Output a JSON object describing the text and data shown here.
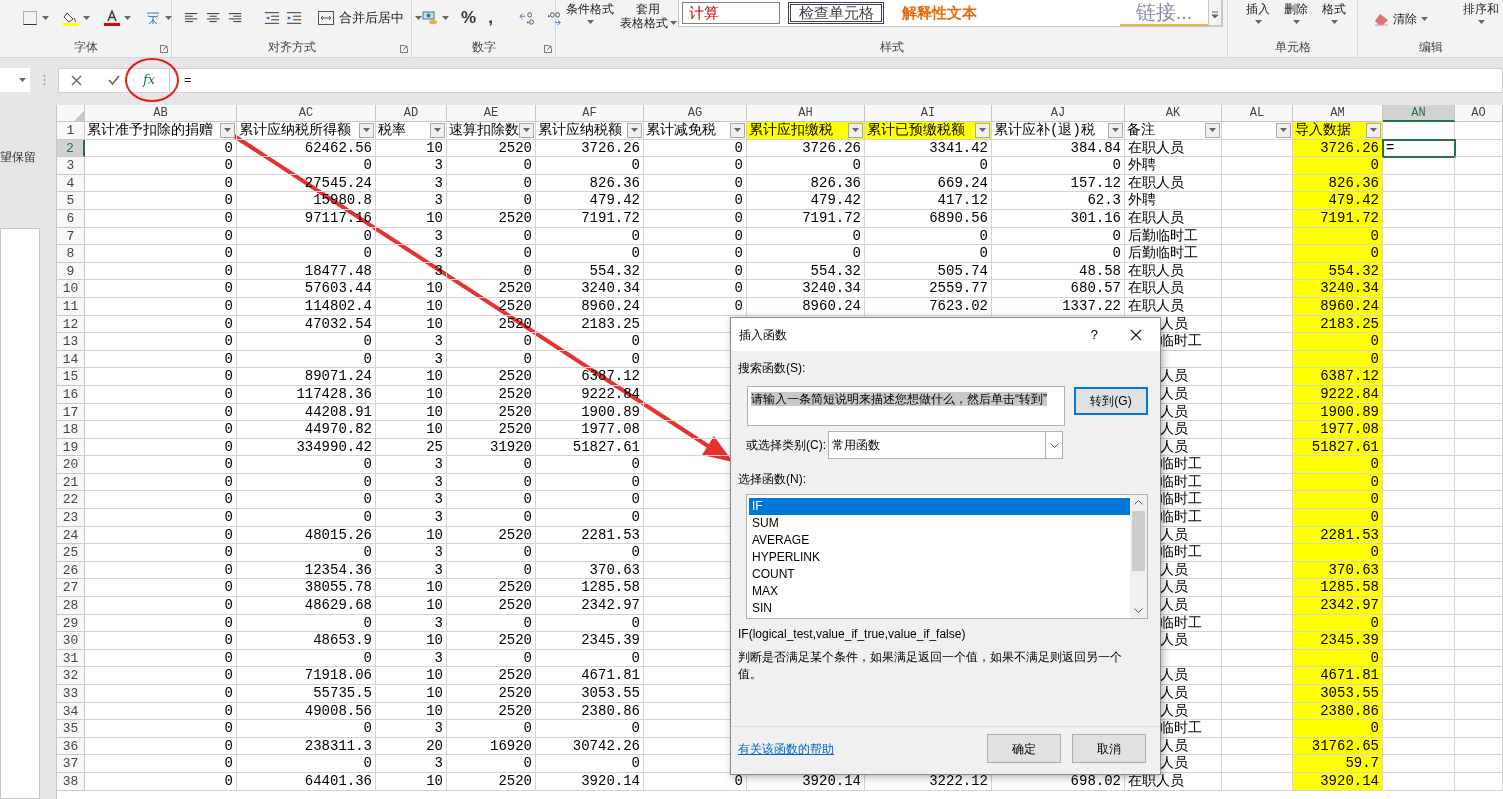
{
  "ribbon": {
    "groups": [
      {
        "label": "字体",
        "launcher": true
      },
      {
        "label": "对齐方式",
        "launcher": true
      },
      {
        "label": "数字",
        "launcher": true
      },
      {
        "label": "样式",
        "launcher": false
      },
      {
        "label": "单元格",
        "launcher": false
      },
      {
        "label": "编辑",
        "launcher": false
      }
    ],
    "merge_button": "合并后居中",
    "number_symbols": [
      "%",
      ","
    ],
    "conditional_format": "条件格式",
    "table_format": [
      "套用",
      "表格格式"
    ],
    "cell_styles": [
      {
        "text": "计算",
        "kind": "calc"
      },
      {
        "text": "检查单元格",
        "kind": "check"
      },
      {
        "text": "解释性文本",
        "kind": "explanatory"
      },
      {
        "text": "链接...",
        "kind": "hyperlink"
      }
    ],
    "cell_buttons": [
      "插入",
      "删除",
      "格式"
    ],
    "clear_button": "清除",
    "sort_button": "排序和"
  },
  "formula_bar": {
    "function_button": "fx",
    "formula": "="
  },
  "side_pane": {
    "text": "望保留"
  },
  "columns": [
    {
      "letter": "AB",
      "header": "累计准予扣除的捐赠",
      "kind": "number",
      "filter": true,
      "selected": false
    },
    {
      "letter": "AC",
      "header": "累计应纳税所得额",
      "kind": "number",
      "filter": true,
      "selected": false
    },
    {
      "letter": "AD",
      "header": "税率",
      "kind": "number",
      "filter": true,
      "selected": false
    },
    {
      "letter": "AE",
      "header": "速算扣除数",
      "kind": "number",
      "filter": true,
      "selected": false
    },
    {
      "letter": "AF",
      "header": "累计应纳税额",
      "kind": "number",
      "filter": true,
      "selected": false
    },
    {
      "letter": "AG",
      "header": "累计减免税",
      "kind": "number",
      "filter": true,
      "selected": false
    },
    {
      "letter": "AH",
      "header": "累计应扣缴税",
      "kind": "number",
      "filter": true,
      "selected": false,
      "highlighted": true
    },
    {
      "letter": "AI",
      "header": "累计已预缴税额",
      "kind": "number",
      "filter": true,
      "selected": false,
      "highlighted": true
    },
    {
      "letter": "AJ",
      "header": "累计应补(退)税",
      "kind": "number",
      "filter": true,
      "selected": false
    },
    {
      "letter": "AK",
      "header": "备注",
      "kind": "text",
      "filter": true,
      "selected": false
    },
    {
      "letter": "AL",
      "filter": true,
      "selected": false
    },
    {
      "letter": "AM",
      "header": "导入数据",
      "kind": "number",
      "filter": true,
      "selected": false,
      "highlighted": true,
      "column_highlighted": true
    },
    {
      "letter": "AN",
      "kind": "text",
      "filter": false,
      "selected": true
    },
    {
      "letter": "AO",
      "filter": false,
      "selected": false
    }
  ],
  "header_row": {
    "number": "1"
  },
  "rows": [
    {
      "number": "2",
      "selected": true,
      "cells": [
        "0",
        "62462.56",
        "10",
        "2520",
        "3726.26",
        "0",
        "3726.26",
        "3341.42",
        "384.84",
        "在职人员"
      ],
      "imported": "3726.26",
      "editing": "="
    },
    {
      "number": "3",
      "selected": false,
      "cells": [
        "0",
        "0",
        "3",
        "0",
        "0",
        "0",
        "0",
        "0",
        "0",
        "外聘"
      ],
      "imported": "0"
    },
    {
      "number": "4",
      "selected": false,
      "cells": [
        "0",
        "27545.24",
        "3",
        "0",
        "826.36",
        "0",
        "826.36",
        "669.24",
        "157.12",
        "在职人员"
      ],
      "imported": "826.36"
    },
    {
      "number": "5",
      "selected": false,
      "cells": [
        "0",
        "15980.8",
        "3",
        "0",
        "479.42",
        "0",
        "479.42",
        "417.12",
        "62.3",
        "外聘"
      ],
      "imported": "479.42"
    },
    {
      "number": "6",
      "selected": false,
      "cells": [
        "0",
        "97117.16",
        "10",
        "2520",
        "7191.72",
        "0",
        "7191.72",
        "6890.56",
        "301.16",
        "在职人员"
      ],
      "imported": "7191.72"
    },
    {
      "number": "7",
      "selected": false,
      "cells": [
        "0",
        "0",
        "3",
        "0",
        "0",
        "0",
        "0",
        "0",
        "0",
        "后勤临时工"
      ],
      "imported": "0"
    },
    {
      "number": "8",
      "selected": false,
      "cells": [
        "0",
        "0",
        "3",
        "0",
        "0",
        "0",
        "0",
        "0",
        "0",
        "后勤临时工"
      ],
      "imported": "0"
    },
    {
      "number": "9",
      "selected": false,
      "cells": [
        "0",
        "18477.48",
        "3",
        "0",
        "554.32",
        "0",
        "554.32",
        "505.74",
        "48.58",
        "在职人员"
      ],
      "imported": "554.32"
    },
    {
      "number": "10",
      "selected": false,
      "cells": [
        "0",
        "57603.44",
        "10",
        "2520",
        "3240.34",
        "0",
        "3240.34",
        "2559.77",
        "680.57",
        "在职人员"
      ],
      "imported": "3240.34"
    },
    {
      "number": "11",
      "selected": false,
      "cells": [
        "0",
        "114802.4",
        "10",
        "2520",
        "8960.24",
        "0",
        "8960.24",
        "7623.02",
        "1337.22",
        "在职人员"
      ],
      "imported": "8960.24"
    },
    {
      "number": "12",
      "selected": false,
      "covered": true,
      "cells": [
        "0",
        "47032.54",
        "10",
        "2520",
        "2183.25"
      ],
      "remark_tail": "人员",
      "imported": "2183.25"
    },
    {
      "number": "13",
      "selected": false,
      "covered": true,
      "cells": [
        "0",
        "0",
        "3",
        "0",
        "0"
      ],
      "remark_tail": "临时工",
      "imported": "0"
    },
    {
      "number": "14",
      "selected": false,
      "covered": true,
      "cells": [
        "0",
        "0",
        "3",
        "0",
        "0"
      ],
      "imported": "0"
    },
    {
      "number": "15",
      "selected": false,
      "covered": true,
      "cells": [
        "0",
        "89071.24",
        "10",
        "2520",
        "6387.12"
      ],
      "remark_tail": "人员",
      "imported": "6387.12"
    },
    {
      "number": "16",
      "selected": false,
      "covered": true,
      "cells": [
        "0",
        "117428.36",
        "10",
        "2520",
        "9222.84"
      ],
      "remark_tail": "人员",
      "imported": "9222.84"
    },
    {
      "number": "17",
      "selected": false,
      "covered": true,
      "cells": [
        "0",
        "44208.91",
        "10",
        "2520",
        "1900.89"
      ],
      "remark_tail": "人员",
      "imported": "1900.89"
    },
    {
      "number": "18",
      "selected": false,
      "covered": true,
      "cells": [
        "0",
        "44970.82",
        "10",
        "2520",
        "1977.08"
      ],
      "remark_tail": "人员",
      "imported": "1977.08"
    },
    {
      "number": "19",
      "selected": false,
      "covered": true,
      "cells": [
        "0",
        "334990.42",
        "25",
        "31920",
        "51827.61"
      ],
      "remark_tail": "人员",
      "imported": "51827.61"
    },
    {
      "number": "20",
      "selected": false,
      "covered": true,
      "cells": [
        "0",
        "0",
        "3",
        "0",
        "0"
      ],
      "remark_tail": "临时工",
      "imported": "0"
    },
    {
      "number": "21",
      "selected": false,
      "covered": true,
      "cells": [
        "0",
        "0",
        "3",
        "0",
        "0"
      ],
      "remark_tail": "临时工",
      "imported": "0"
    },
    {
      "number": "22",
      "selected": false,
      "covered": true,
      "cells": [
        "0",
        "0",
        "3",
        "0",
        "0"
      ],
      "remark_tail": "临时工",
      "imported": "0"
    },
    {
      "number": "23",
      "selected": false,
      "covered": true,
      "cells": [
        "0",
        "0",
        "3",
        "0",
        "0"
      ],
      "remark_tail": "临时工",
      "imported": "0"
    },
    {
      "number": "24",
      "selected": false,
      "covered": true,
      "cells": [
        "0",
        "48015.26",
        "10",
        "2520",
        "2281.53"
      ],
      "remark_tail": "人员",
      "imported": "2281.53"
    },
    {
      "number": "25",
      "selected": false,
      "covered": true,
      "cells": [
        "0",
        "0",
        "3",
        "0",
        "0"
      ],
      "remark_tail": "临时工",
      "imported": "0"
    },
    {
      "number": "26",
      "selected": false,
      "covered": true,
      "cells": [
        "0",
        "12354.36",
        "3",
        "0",
        "370.63"
      ],
      "remark_tail": "人员",
      "imported": "370.63"
    },
    {
      "number": "27",
      "selected": false,
      "covered": true,
      "cells": [
        "0",
        "38055.78",
        "10",
        "2520",
        "1285.58"
      ],
      "remark_tail": "人员",
      "imported": "1285.58"
    },
    {
      "number": "28",
      "selected": false,
      "covered": true,
      "cells": [
        "0",
        "48629.68",
        "10",
        "2520",
        "2342.97"
      ],
      "remark_tail": "人员",
      "imported": "2342.97"
    },
    {
      "number": "29",
      "selected": false,
      "covered": true,
      "cells": [
        "0",
        "0",
        "3",
        "0",
        "0"
      ],
      "remark_tail": "临时工",
      "imported": "0"
    },
    {
      "number": "30",
      "selected": false,
      "covered": true,
      "cells": [
        "0",
        "48653.9",
        "10",
        "2520",
        "2345.39"
      ],
      "remark_tail": "人员",
      "imported": "2345.39"
    },
    {
      "number": "31",
      "selected": false,
      "covered": true,
      "cells": [
        "0",
        "0",
        "3",
        "0",
        "0"
      ],
      "imported": "0"
    },
    {
      "number": "32",
      "selected": false,
      "covered": true,
      "cells": [
        "0",
        "71918.06",
        "10",
        "2520",
        "4671.81"
      ],
      "remark_tail": "人员",
      "imported": "4671.81"
    },
    {
      "number": "33",
      "selected": false,
      "covered": true,
      "cells": [
        "0",
        "55735.5",
        "10",
        "2520",
        "3053.55"
      ],
      "remark_tail": "人员",
      "imported": "3053.55"
    },
    {
      "number": "34",
      "selected": false,
      "covered": true,
      "cells": [
        "0",
        "49008.56",
        "10",
        "2520",
        "2380.86"
      ],
      "remark_tail": "人员",
      "imported": "2380.86"
    },
    {
      "number": "35",
      "selected": false,
      "covered": true,
      "cells": [
        "0",
        "0",
        "3",
        "0",
        "0"
      ],
      "remark_tail": "临时工",
      "imported": "0"
    },
    {
      "number": "36",
      "selected": false,
      "covered": true,
      "cells": [
        "0",
        "238311.3",
        "20",
        "16920",
        "30742.26"
      ],
      "remark_tail": "人员",
      "imported": "31762.65"
    },
    {
      "number": "37",
      "selected": false,
      "covered": true,
      "cells": [
        "0",
        "0",
        "3",
        "0",
        "0"
      ],
      "remark_tail": "人员",
      "imported": "59.7"
    },
    {
      "number": "38",
      "selected": false,
      "cells": [
        "0",
        "64401.36",
        "10",
        "2520",
        "3920.14",
        "0",
        "3920.14",
        "3222.12",
        "698.02",
        "在职人员"
      ],
      "imported": "3920.14"
    }
  ],
  "dialog": {
    "title": "插入函数",
    "help": "?",
    "search_label": "搜索函数(S):",
    "search_value": "请输入一条简短说明来描述您想做什么，然后单击“转到”",
    "go_button": "转到(G)",
    "category_label": "或选择类别(C):",
    "category_value": "常用函数",
    "function_label": "选择函数(N):",
    "functions": [
      {
        "name": "IF",
        "selected": true
      },
      {
        "name": "SUM",
        "selected": false
      },
      {
        "name": "AVERAGE",
        "selected": false
      },
      {
        "name": "HYPERLINK",
        "selected": false
      },
      {
        "name": "COUNT",
        "selected": false
      },
      {
        "name": "MAX",
        "selected": false
      },
      {
        "name": "SIN",
        "selected": false
      }
    ],
    "syntax": "IF(logical_test,value_if_true,value_if_false)",
    "description": "判断是否满足某个条件，如果满足返回一个值，如果不满足则返回另一个值。",
    "help_link": "有关该函数的帮助",
    "buttons": [
      "确定",
      "取消"
    ]
  }
}
